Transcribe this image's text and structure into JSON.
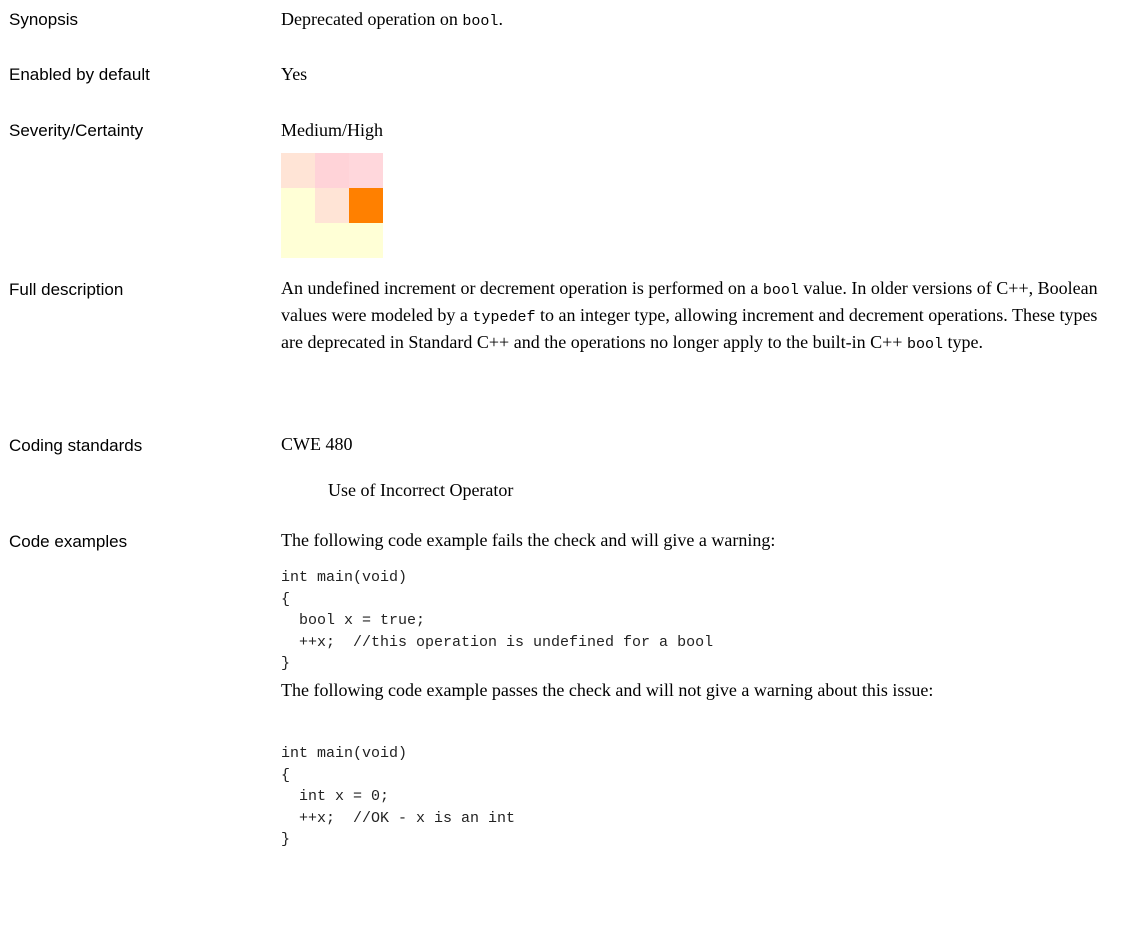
{
  "labels": {
    "synopsis": "Synopsis",
    "enabled": "Enabled by default",
    "severity": "Severity/Certainty",
    "full_description": "Full description",
    "coding_standards": "Coding standards",
    "code_examples": "Code examples"
  },
  "synopsis": {
    "before": "Deprecated operation on ",
    "code": "bool",
    "after": "."
  },
  "enabled": "Yes",
  "severity": "Medium/High",
  "severity_matrix": {
    "colors": [
      [
        "#ffe4d6",
        "#ffd3d8",
        "#ffd7dc"
      ],
      [
        "#ffffd6",
        "#ffe4d6",
        "#ff8000"
      ],
      [
        "#ffffd6",
        "#ffffd6",
        "#ffffd6"
      ]
    ]
  },
  "description": {
    "s1": "An undefined increment or decrement operation is performed on a ",
    "c1": "bool",
    "s2": " value.  In older versions of C++, Boolean values were modeled by a ",
    "c2": "typedef",
    "s3": " to an integer type, allowing increment and decrement operations. These types are deprecated in Standard C++ and the operations no longer apply to the built-in C++ ",
    "c3": "bool",
    "s4": " type."
  },
  "coding_standards": {
    "id": "CWE 480",
    "title": "Use of Incorrect Operator"
  },
  "examples": {
    "fail_intro": "The following code example fails the check and will give a warning:",
    "fail_code": "int main(void)\n{\n  bool x = true;\n  ++x;  //this operation is undefined for a bool\n}",
    "pass_intro": "The following code example passes the check and will not give a warning about this issue:",
    "pass_code": "int main(void)\n{\n  int x = 0;\n  ++x;  //OK - x is an int\n}"
  }
}
